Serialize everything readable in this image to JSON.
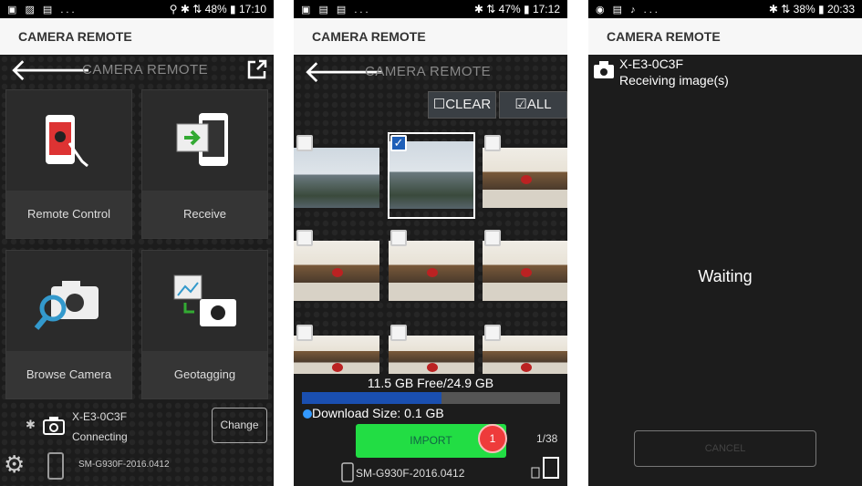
{
  "screens": [
    {
      "status": {
        "left": "▣ ▨ ▤ ...",
        "right": "⚲ ✱ ⇅ 48% ▮ 17:10"
      },
      "appbar_title": "CAMERA REMOTE",
      "header_title": "CAMERA REMOTE",
      "tiles": [
        {
          "label": "Remote Control",
          "icon": "remote-control-icon"
        },
        {
          "label": "Receive",
          "icon": "receive-icon"
        },
        {
          "label": "Browse Camera",
          "icon": "browse-camera-icon"
        },
        {
          "label": "Geotagging",
          "icon": "geotagging-icon"
        }
      ],
      "camera_name": "X-E3-0C3F",
      "camera_status": "Connecting",
      "change_label": "Change",
      "device_name": "SM-G930F-2016.0412"
    },
    {
      "status": {
        "left": "▣ ▤ ▤ ...",
        "right": "✱ ⇅ 47% ▮ 17:12"
      },
      "appbar_title": "CAMERA REMOTE",
      "header_title": "CAMERA REMOTE",
      "clear_label": "CLEAR",
      "all_label": "ALL",
      "storage": "11.5 GB Free/24.9 GB",
      "storage_used_fraction": 0.54,
      "download_size": "Download Size: 0.1 GB",
      "import_label": "IMPORT",
      "selected_count": "1",
      "page": "1/38",
      "device_name": "SM-G930F-2016.0412",
      "colors": {
        "import": "#22dd44",
        "badge": "#ee3b3b",
        "bar": "#1a4fb0"
      }
    },
    {
      "status": {
        "left": "◉ ▤ ♪ ...",
        "right": "✱ ⇅ 38% ▮ 20:33"
      },
      "appbar_title": "CAMERA REMOTE",
      "camera_name": "X-E3-0C3F",
      "camera_status": "Receiving image(s)",
      "waiting": "Waiting",
      "cancel_label": "CANCEL"
    }
  ]
}
